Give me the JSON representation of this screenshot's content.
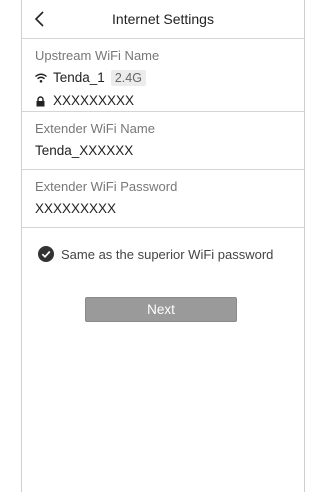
{
  "header": {
    "title": "Internet Settings",
    "back_icon": "chevron-left-icon"
  },
  "upstream": {
    "label": "Upstream WiFi Name",
    "ssid": "Tenda_1",
    "band": "2.4G",
    "password": "XXXXXXXXX",
    "wifi_icon": "wifi-icon",
    "lock_icon": "lock-icon"
  },
  "extender_name": {
    "label": "Extender WiFi Name",
    "value": "Tenda_XXXXXX"
  },
  "extender_password": {
    "label": "Extender WiFi Password",
    "value": "XXXXXXXXX"
  },
  "same_password": {
    "label": "Same as the superior WiFi password",
    "checked": true,
    "icon": "check-circle-icon"
  },
  "next_button": {
    "label": "Next",
    "color": "#9a9a9a"
  }
}
